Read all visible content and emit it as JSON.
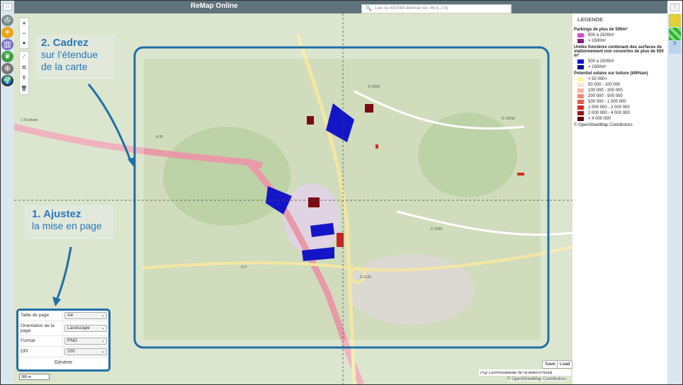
{
  "header": {
    "title": "ReMap Online",
    "search_placeholder": "Lieu ou WGS84 décimal (ex: 46.6, 2.5)"
  },
  "left_tools": [
    {
      "icon": "wind-turbine-icon",
      "color": "#7a8c8c",
      "glyph": "✇"
    },
    {
      "icon": "sun-icon",
      "color": "#e8a317",
      "glyph": "☀"
    },
    {
      "icon": "city-icon",
      "color": "#7b6fc8",
      "glyph": "▥"
    },
    {
      "icon": "leaf-icon",
      "color": "#3ea03e",
      "glyph": "❦"
    },
    {
      "icon": "grid-globe-icon",
      "color": "#777777",
      "glyph": "⊕"
    },
    {
      "icon": "globe-icon",
      "color": "#333333",
      "glyph": "🌍"
    }
  ],
  "zoom_controls": {
    "zoom_in": "+",
    "zoom_out": "−",
    "north": "▲"
  },
  "draw_controls": [
    {
      "icon": "line-icon",
      "glyph": "⟋"
    },
    {
      "icon": "square-icon",
      "glyph": "◘"
    },
    {
      "icon": "marker-icon",
      "glyph": "⚲"
    },
    {
      "icon": "trash-icon",
      "glyph": "🗑"
    }
  ],
  "callouts": {
    "frame": {
      "title": "2. Cadrez",
      "line1": "sur l’étendue",
      "line2": "de la carte"
    },
    "layout": {
      "title": "1. Ajustez",
      "line1": "la mise en page"
    }
  },
  "print_panel": {
    "rows": [
      {
        "label": "Taille de page",
        "value": "A4"
      },
      {
        "label": "Orientation de la page",
        "value": "Landscape"
      },
      {
        "label": "Format",
        "value": "PNG"
      },
      {
        "label": "DPI",
        "value": "200"
      }
    ],
    "generate": "Générer"
  },
  "scale": "300 m",
  "buttons": {
    "save": "Save",
    "load": "Load"
  },
  "coordinates": "{\"lng\":1.53787915980486,\"lat\":45.5858072778159}",
  "attribution": "© OpenStreetMap Contributors",
  "accent": "#1e6fa8",
  "legend": {
    "title": "LEGENDE",
    "sections": [
      {
        "title": "Parkings de plus de 500m²",
        "items": [
          {
            "label": "500 à 1500m²",
            "color": "#d64fc8"
          },
          {
            "label": "> 1500m²",
            "color": "#8a1a7a"
          }
        ]
      },
      {
        "title": "Unités foncières contenant des surfaces de stationnement non couvertes de plus de 500 m²",
        "items": [
          {
            "label": "500 à 1500m²",
            "color": "#1010ee"
          },
          {
            "label": "> 1500m²",
            "color": "#0a0a90"
          }
        ]
      },
      {
        "title": "Potentiel solaire sur toiture (kWh/an)",
        "items": [
          {
            "label": "< 50 000>",
            "color": "#fff59d"
          },
          {
            "label": "50 000 - 100 000",
            "color": "#fde0d6"
          },
          {
            "label": "100 000 - 200 000",
            "color": "#f9b4a0"
          },
          {
            "label": "200 000 - 500 000",
            "color": "#f4876c"
          },
          {
            "label": "500 000 - 1 000 000",
            "color": "#ea5a40"
          },
          {
            "label": "1 000 000 - 2 000 000",
            "color": "#d42a22"
          },
          {
            "label": "2 000 000 - 4 000 000",
            "color": "#a3101a"
          },
          {
            "label": "> 4 000 000",
            "color": "#5e0610"
          }
        ]
      }
    ],
    "attribution": "© OpenStreetMap Contributors"
  },
  "map_labels": [
    "D 1120",
    "D 2343",
    "D 9206",
    "D 14255",
    "D 9",
    "A 20",
    "L'Occitane"
  ]
}
